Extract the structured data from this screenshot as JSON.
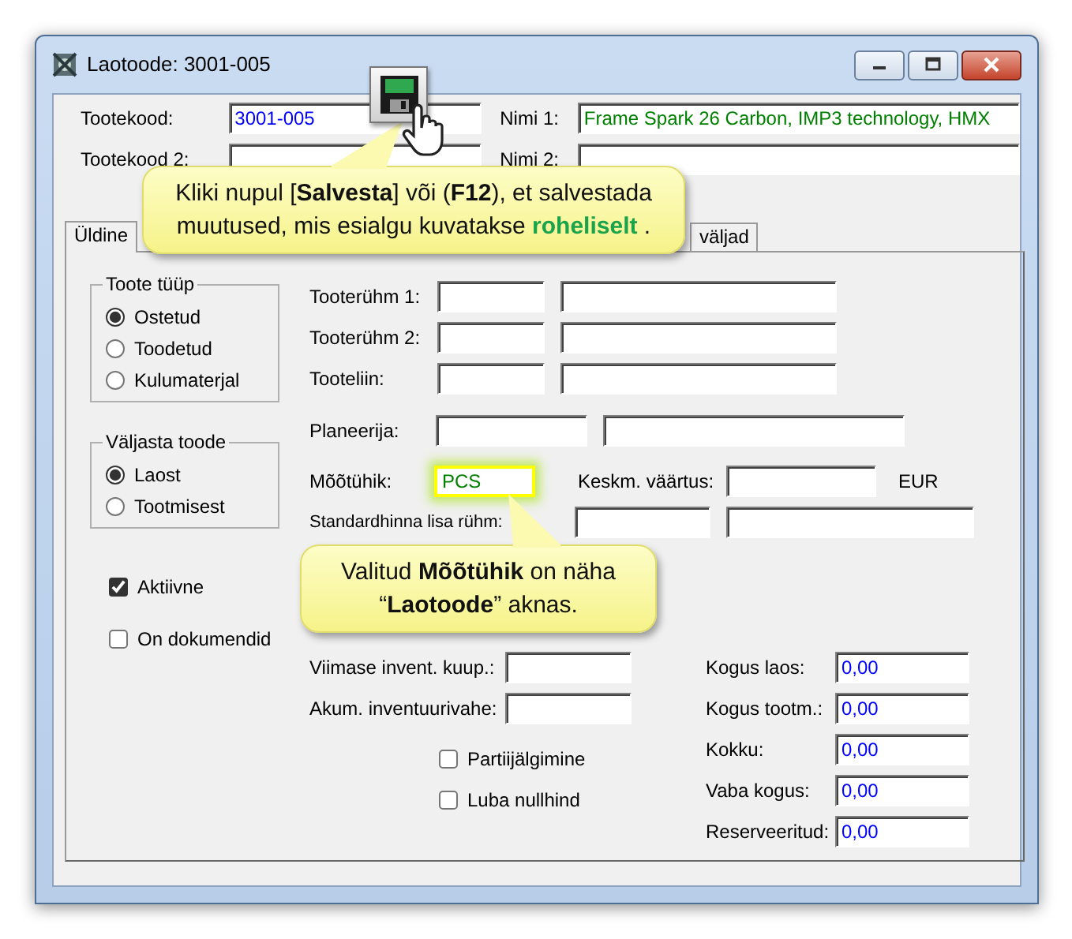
{
  "window": {
    "title": "Laotoode: 3001-005"
  },
  "header_fields": [
    {
      "label": "Tootekood:",
      "value": "3001-005",
      "kind": "key"
    },
    {
      "label": "Nimi 1:",
      "value": "Frame Spark 26 Carbon, IMP3 technology, HMX",
      "kind": "modified"
    },
    {
      "label": "Tootekood 2:",
      "kind": "plain"
    },
    {
      "label": "Nimi 2:",
      "kind": "plain"
    }
  ],
  "tabs": [
    {
      "label": "Üldine",
      "selected": true
    },
    {
      "label": "väljad",
      "selected": false
    }
  ],
  "product_type": {
    "title": "Toote tüüp",
    "options": [
      {
        "label": "Ostetud",
        "selected": true
      },
      {
        "label": "Toodetud",
        "selected": false
      },
      {
        "label": "Kulumaterjal",
        "selected": false
      }
    ]
  },
  "issue_from": {
    "title": "Väljasta toode",
    "options": [
      {
        "label": "Laost",
        "selected": true
      },
      {
        "label": "Tootmisest",
        "selected": false
      }
    ]
  },
  "flags": [
    {
      "label": "Aktiivne",
      "checked": true
    },
    {
      "label": "On dokumendid",
      "checked": false
    }
  ],
  "group_fields": [
    {
      "label": "Tooterühm 1:"
    },
    {
      "label": "Tooterühm 2:"
    },
    {
      "label": "Tooteliin:"
    }
  ],
  "planner": {
    "label": "Planeerija:"
  },
  "unit": {
    "label": "Mõõtühik:",
    "value": "PCS",
    "highlighted": true
  },
  "avg_value": {
    "label": "Keskm. väärtus:",
    "currency": "EUR"
  },
  "std_price_group": {
    "label": "Standardhinna lisa rühm:"
  },
  "inventory_fields": [
    {
      "label": "Viimase invent. kuup.:"
    },
    {
      "label": "Akum. inventuurivahe:"
    }
  ],
  "options": [
    {
      "label": "Partiijälgimine",
      "checked": false
    },
    {
      "label": "Luba nullhind",
      "checked": false
    }
  ],
  "quantities": [
    {
      "label": "Kogus laos:",
      "value": "0,00"
    },
    {
      "label": "Kogus tootm.:",
      "value": "0,00"
    },
    {
      "label": "Kokku:",
      "value": "0,00"
    },
    {
      "label": "Vaba kogus:",
      "value": "0,00"
    },
    {
      "label": "Reserveeritud:",
      "value": "0,00"
    }
  ],
  "callouts": [
    {
      "kind": "save",
      "text": "Kliki nupul [**Salvesta**] või (**F12**), et salvestada muutused, mis esialgu kuvatakse **roheliselt** ."
    },
    {
      "kind": "unit",
      "text": "Valitud **Mõõtühik** on näha “**Laotoode**” aknas."
    }
  ]
}
